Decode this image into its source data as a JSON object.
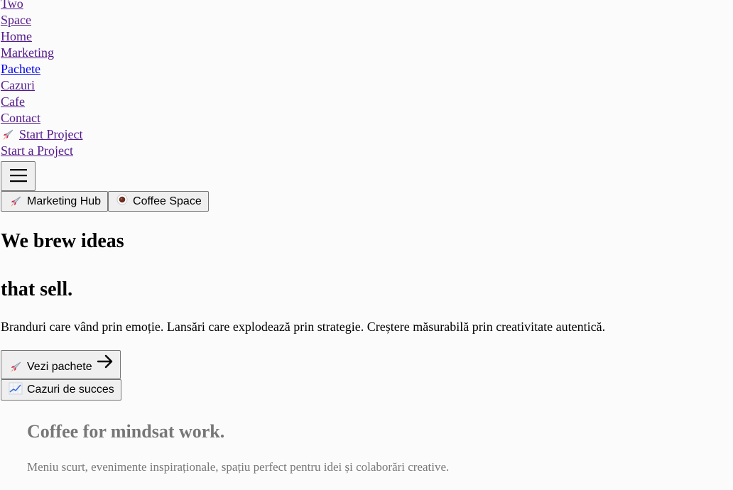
{
  "nav": {
    "links": [
      {
        "label": "Two"
      },
      {
        "label": "Space"
      },
      {
        "label": "Home"
      },
      {
        "label": "Marketing"
      },
      {
        "label": "Pachete"
      },
      {
        "label": "Cazuri"
      },
      {
        "label": "Cafe"
      },
      {
        "label": "Contact"
      }
    ],
    "start_project_label": "Start Project",
    "start_project_icon": "rocket-icon",
    "start_a_project_label": "Start a Project",
    "menu_icon": "hamburger-menu-icon"
  },
  "switcher": {
    "marketing_label": "Marketing Hub",
    "marketing_icon": "rocket-icon",
    "coffee_label": "Coffee Space",
    "coffee_icon": "coffee-icon"
  },
  "hero": {
    "title_line1": "We brew ideas",
    "title_line2": "that sell.",
    "subtitle": "Branduri care vând prin emoție. Lansări care explodează prin strategie. Creștere măsurabilă prin creativitate autentică.",
    "cta_primary": "Vezi pachete",
    "cta_primary_icon": "arrow-right-icon",
    "cta_secondary": "Cazuri de succes",
    "cta_secondary_icon": "chart-icon"
  },
  "coffee": {
    "title": "Coffee for mindsat work.",
    "subtitle": "Meniu scurt, evenimente inspiraționale, spațiu perfect pentru idei și colaborări creative."
  },
  "colors": {
    "visited_link": "#551a8b",
    "link": "#0000ee",
    "button_bg": "#efefef",
    "muted_text": "#777777"
  }
}
